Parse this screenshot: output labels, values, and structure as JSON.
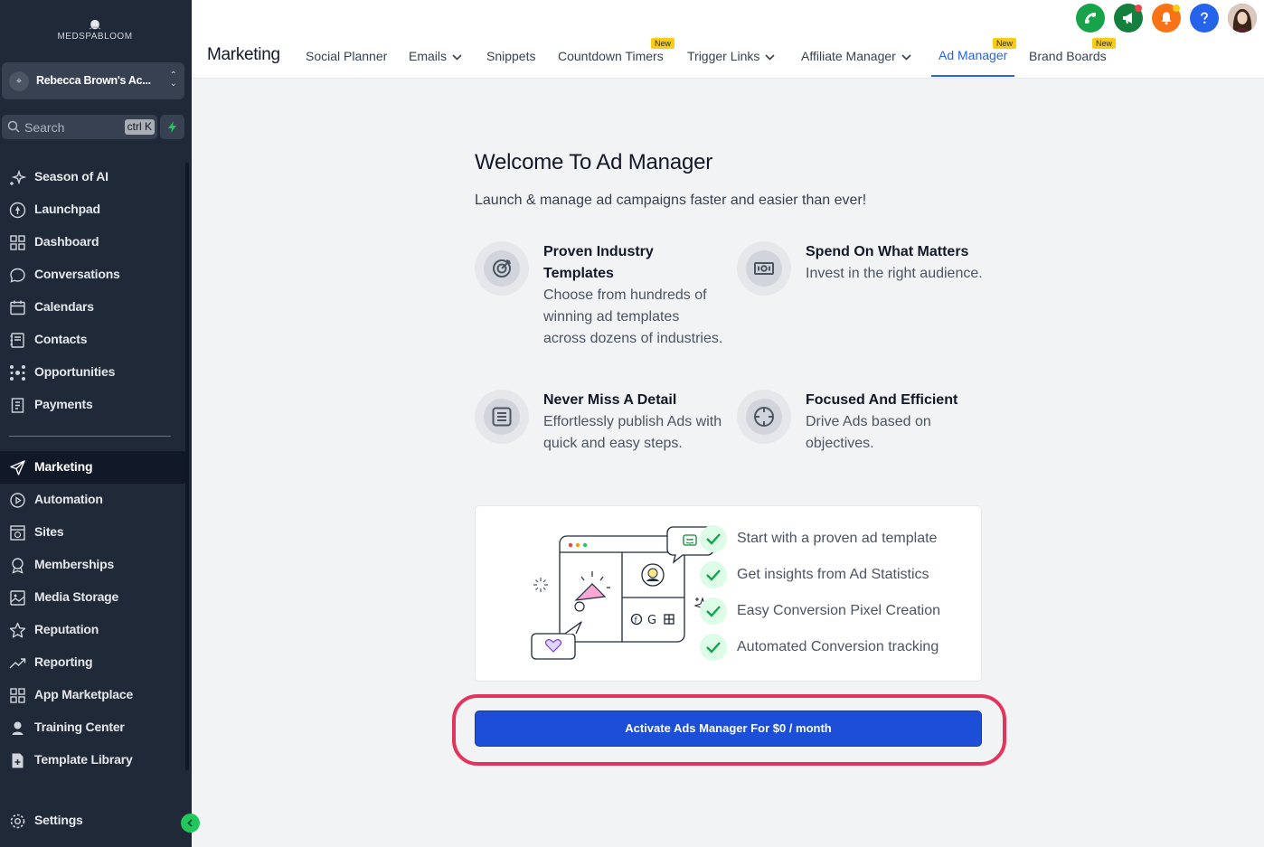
{
  "brand": {
    "name": "MEDSPABLOOM"
  },
  "account": {
    "name": "Rebecca Brown's Ac..."
  },
  "search": {
    "placeholder": "Search",
    "shortcut": "ctrl K"
  },
  "sidebar": {
    "items": [
      {
        "label": "Season of AI",
        "icon": "sparkle-icon"
      },
      {
        "label": "Launchpad",
        "icon": "rocket-icon"
      },
      {
        "label": "Dashboard",
        "icon": "grid-icon"
      },
      {
        "label": "Conversations",
        "icon": "chat-icon"
      },
      {
        "label": "Calendars",
        "icon": "calendar-icon"
      },
      {
        "label": "Contacts",
        "icon": "contacts-icon"
      },
      {
        "label": "Opportunities",
        "icon": "network-icon"
      },
      {
        "label": "Payments",
        "icon": "receipt-icon"
      },
      {
        "label": "Marketing",
        "icon": "send-icon",
        "active": true
      },
      {
        "label": "Automation",
        "icon": "automation-icon"
      },
      {
        "label": "Sites",
        "icon": "globe-icon"
      },
      {
        "label": "Memberships",
        "icon": "award-icon"
      },
      {
        "label": "Media Storage",
        "icon": "image-icon"
      },
      {
        "label": "Reputation",
        "icon": "star-icon"
      },
      {
        "label": "Reporting",
        "icon": "trend-icon"
      },
      {
        "label": "App Marketplace",
        "icon": "apps-icon"
      },
      {
        "label": "Training Center",
        "icon": "user-icon"
      },
      {
        "label": "Template Library",
        "icon": "file-plus-icon"
      }
    ],
    "settings_label": "Settings"
  },
  "header": {
    "section_title": "Marketing",
    "tabs": [
      {
        "label": "Social Planner"
      },
      {
        "label": "Emails",
        "dropdown": true
      },
      {
        "label": "Snippets"
      },
      {
        "label": "Countdown Timers",
        "badge": "New"
      },
      {
        "label": "Trigger Links",
        "dropdown": true
      },
      {
        "label": "Affiliate Manager",
        "dropdown": true
      },
      {
        "label": "Ad Manager",
        "badge": "New",
        "active": true
      },
      {
        "label": "Brand Boards",
        "badge": "New"
      }
    ]
  },
  "top_icons": [
    "phone-icon",
    "megaphone-icon",
    "bell-icon",
    "help-icon",
    "avatar"
  ],
  "main": {
    "title": "Welcome To Ad Manager",
    "subtitle": "Launch & manage ad campaigns faster and easier than ever!",
    "features": [
      {
        "title": "Proven Industry Templates",
        "desc": "Choose from hundreds of winning ad templates across dozens of industries.",
        "icon": "target-icon"
      },
      {
        "title": "Spend On What Matters",
        "desc": "Invest in the right audience.",
        "icon": "money-icon"
      },
      {
        "title": "Never Miss A Detail",
        "desc": "Effortlessly publish Ads with quick and easy steps.",
        "icon": "list-icon"
      },
      {
        "title": "Focused And Efficient",
        "desc": "Drive Ads based on objectives.",
        "icon": "crosshair-icon"
      }
    ],
    "checklist": [
      "Start with a proven ad template",
      "Get insights from Ad Statistics",
      "Easy Conversion Pixel Creation",
      "Automated Conversion tracking"
    ],
    "cta_label": "Activate Ads Manager For $0 / month"
  },
  "colors": {
    "sidebar_bg": "#1f2937",
    "accent_blue": "#1d4ed8",
    "highlight_red": "#e3345d",
    "badge_yellow": "#facc15",
    "check_green": "#22c55e"
  }
}
